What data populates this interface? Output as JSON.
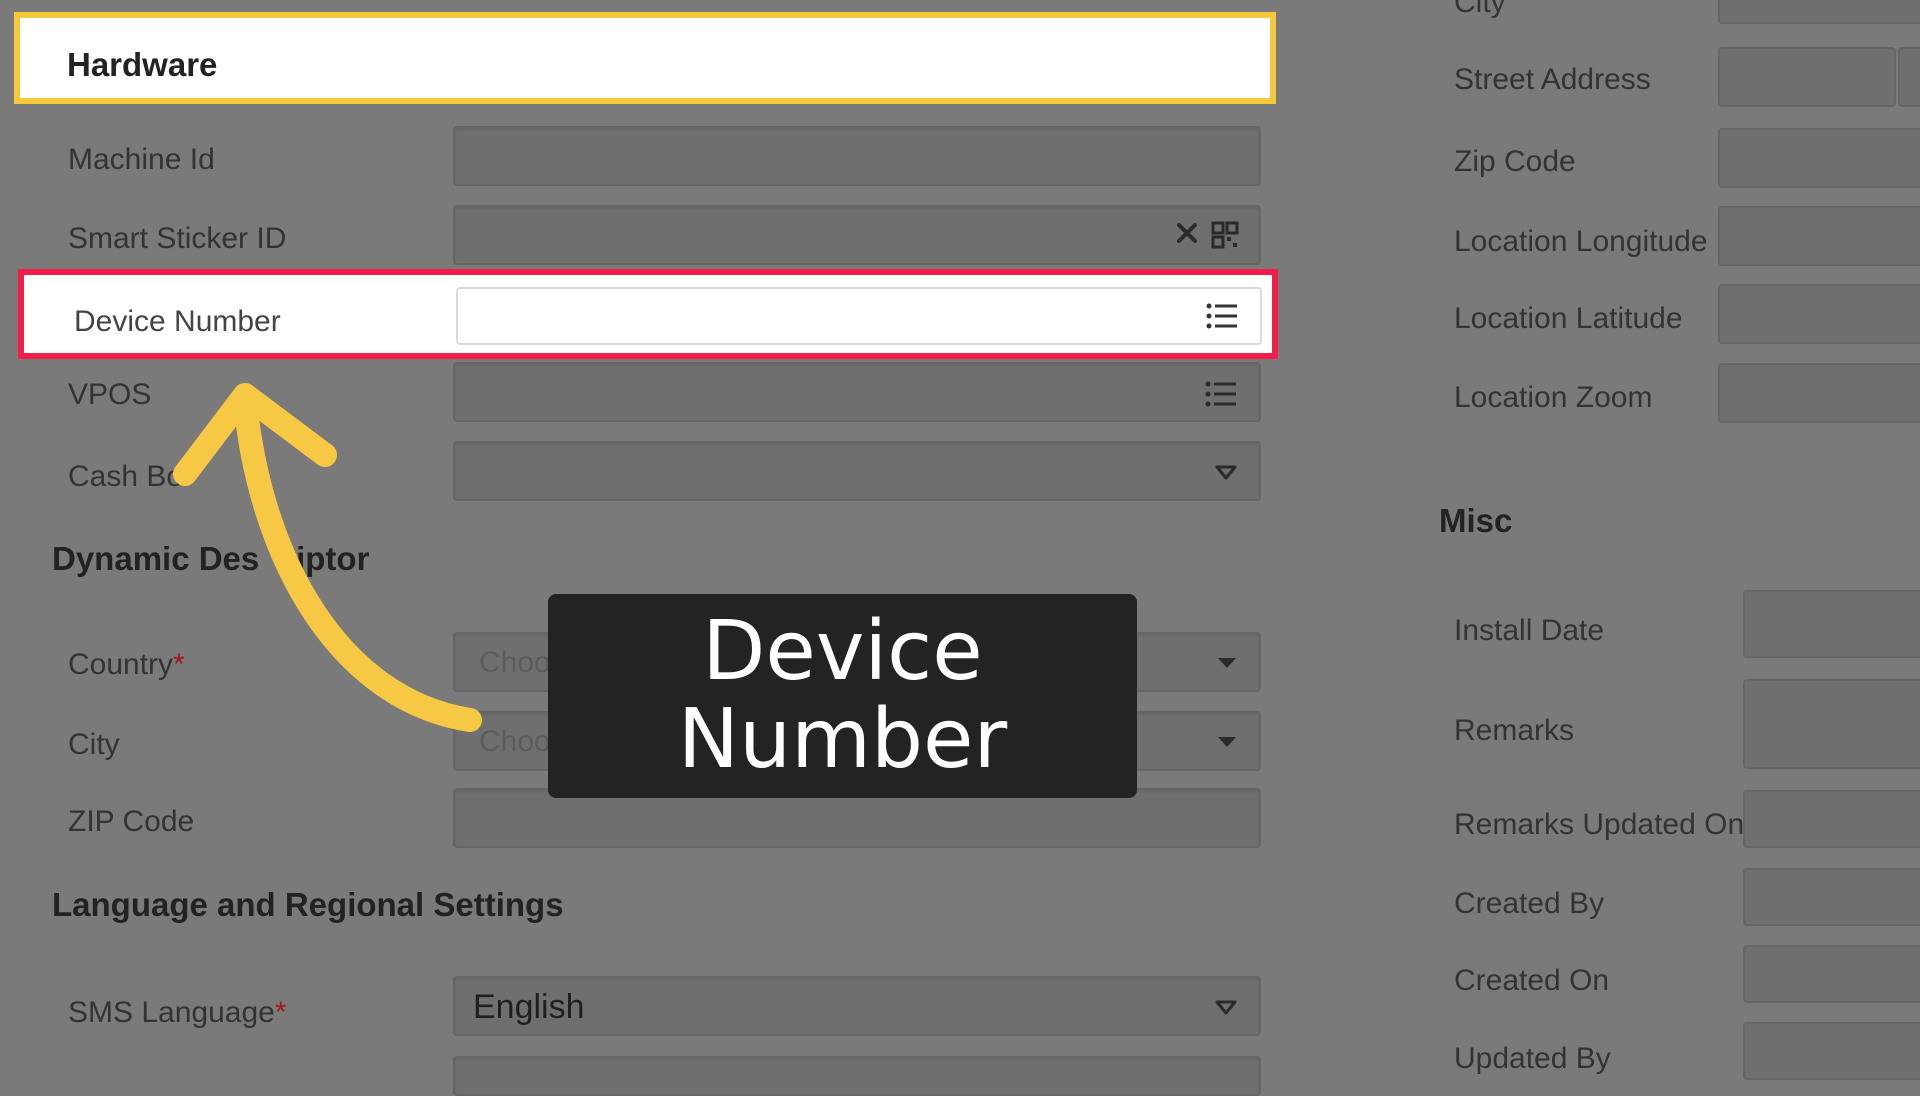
{
  "hardware": {
    "title": "Hardware",
    "fields": {
      "machine_id": "Machine Id",
      "smart_sticker_id": "Smart Sticker ID",
      "device_number": "Device Number",
      "vpos": "VPOS",
      "cash_box": "Cash Bo"
    }
  },
  "dynamic_descriptor": {
    "title_left": "Dynamic Des",
    "title_right": "riptor",
    "country_label": "Country",
    "country_placeholder": "Choose...",
    "city_label": "City",
    "city_placeholder": "Choose...",
    "zip_label": "ZIP Code",
    "required_mark": "*"
  },
  "language": {
    "title": "Language and Regional Settings",
    "sms_language_label": "SMS Language",
    "sms_language_value": "English"
  },
  "right_column": {
    "city_partial": "City",
    "street_address": "Street Address",
    "zip_code": "Zip Code",
    "location_longitude": "Location Longitude",
    "location_latitude": "Location Latitude",
    "location_zoom": "Location Zoom"
  },
  "misc": {
    "title": "Misc",
    "install_date": "Install Date",
    "remarks": "Remarks",
    "remarks_updated_on": "Remarks Updated On",
    "created_by": "Created By",
    "created_on": "Created On",
    "updated_by": "Updated By"
  },
  "callout": {
    "text": "Device Number"
  },
  "colors": {
    "highlight_yellow": "#f5c93a",
    "highlight_red": "#f01e49",
    "arrow": "#f7c843",
    "overlay_gray": "#7a7a7a",
    "callout_bg": "#232323"
  }
}
